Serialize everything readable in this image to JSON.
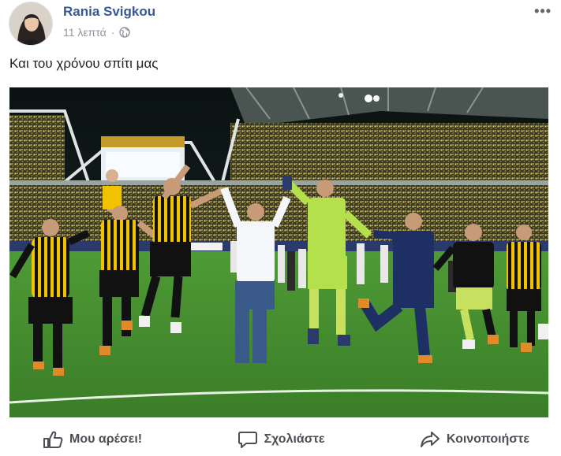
{
  "post": {
    "author": "Rania Svigkou",
    "time": "11 λεπτά",
    "separator": "·",
    "privacy_icon": "globe-icon",
    "menu_icon": "more-options-icon",
    "menu_label": "•••",
    "text": "Και του χρόνου σπίτι μας"
  },
  "photo": {
    "subject": "football-celebration-photo"
  },
  "actions": {
    "like": {
      "label": "Μου αρέσει!",
      "icon": "thumbs-up-icon"
    },
    "comment": {
      "label": "Σχολιάστε",
      "icon": "comment-icon"
    },
    "share": {
      "label": "Κοινοποιήστε",
      "icon": "share-icon"
    }
  },
  "colors": {
    "author": "#365899",
    "meta": "#90949c",
    "action": "#4b4f56",
    "pitch": "#3f8a2e",
    "kit_yellow": "#f2c200",
    "kit_black": "#111111",
    "keeper_green": "#b4e04c",
    "staff_navy": "#1d2f63"
  }
}
